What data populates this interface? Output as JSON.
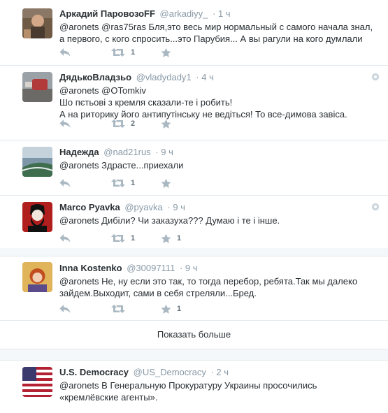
{
  "tweets": [
    {
      "name": "Аркадий ПаровозоFF",
      "handle": "@arkadiyy_",
      "time": "· 1 ч",
      "text": "@aronets @ras75ras Бля,это весь мир нормальный с самого начала знал, а первого, с кого спросить...это Парубия... А вы рагули на кого думлали",
      "retweets": "1",
      "favorites": ""
    },
    {
      "name": "ДядькоВладзьо",
      "handle": "@vladydady1",
      "time": "· 4 ч",
      "text": "@aronets @OTomkiv\nШо пєтьові з кремля сказали-те і робить!\nА на риторику його антипутінську не ведіться! То все-димова завіса.",
      "retweets": "2",
      "favorites": ""
    },
    {
      "name": "Надежда",
      "handle": "@nad21rus",
      "time": "· 9 ч",
      "text": "@aronets Здрасте...приехали",
      "retweets": "1",
      "favorites": ""
    },
    {
      "name": "Marco Pyavka",
      "handle": "@pyavka",
      "time": "· 9 ч",
      "text": "@aronets Дибіли? Чи заказуха??? Думаю і те і інше.",
      "retweets": "1",
      "favorites": "1"
    },
    {
      "name": "Inna Kostenko",
      "handle": "@30097111",
      "time": "· 9 ч",
      "text": "@aronets Не, ну если это так, то тогда перебор, ребята.Так мы далеко зайдем.Выходит, сами в себя стреляли...Бред.",
      "retweets": "",
      "favorites": "1"
    }
  ],
  "show_more": "Показать больше",
  "last_tweet": {
    "name": "U.S. Democracy",
    "handle": "@US_Democracy",
    "time": "· 2 ч",
    "text": "@aronets В Генеральную Прокуратуру Украины просочились «кремлёвские агенты»."
  },
  "icons": {
    "reply": "reply-icon",
    "retweet": "retweet-icon",
    "favorite": "star-icon",
    "more": "gear-icon"
  },
  "colors": {
    "text": "#292f33",
    "muted": "#8899a6",
    "icon": "#aab8c2",
    "border": "#e1e8ed",
    "gap": "#f5f8fa"
  }
}
